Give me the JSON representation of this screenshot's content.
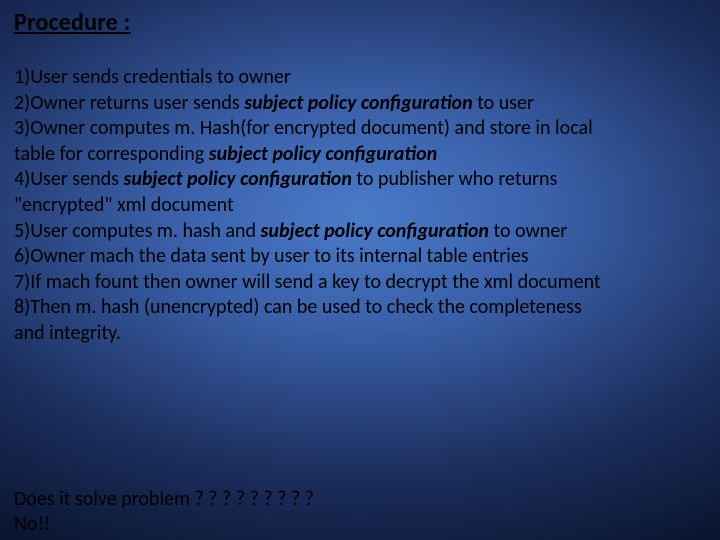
{
  "title": "Procedure :",
  "steps": {
    "s1": "1)User sends credentials to  owner",
    "s2a": "2)Owner returns user sends ",
    "s2b": "subject policy configuration",
    "s2c": " to user",
    "s3a": "3)Owner computes m. Hash(for encrypted document) and store in local",
    "s3b": "table for corresponding    ",
    "s3c": "subject policy configuration",
    "s4a": "4)User sends ",
    "s4b": "subject policy configuration",
    "s4c": " to publisher who returns",
    "s4d": "\"encrypted\" xml document",
    "s5a": "5)User computes m. hash and ",
    "s5b": "subject policy configuration",
    "s5c": " to owner",
    "s6": "6)Owner mach the data sent by user to its internal table entries",
    "s7": "7)If mach fount then owner will send a key to decrypt the xml document",
    "s8a": "8)Then m. hash (unencrypted) can be used to check the completeness",
    "s8b": "and integrity."
  },
  "footer": {
    "q": "Does it solve problem ? ? ? ? ? ? ? ? ?",
    "a": "No!!"
  }
}
